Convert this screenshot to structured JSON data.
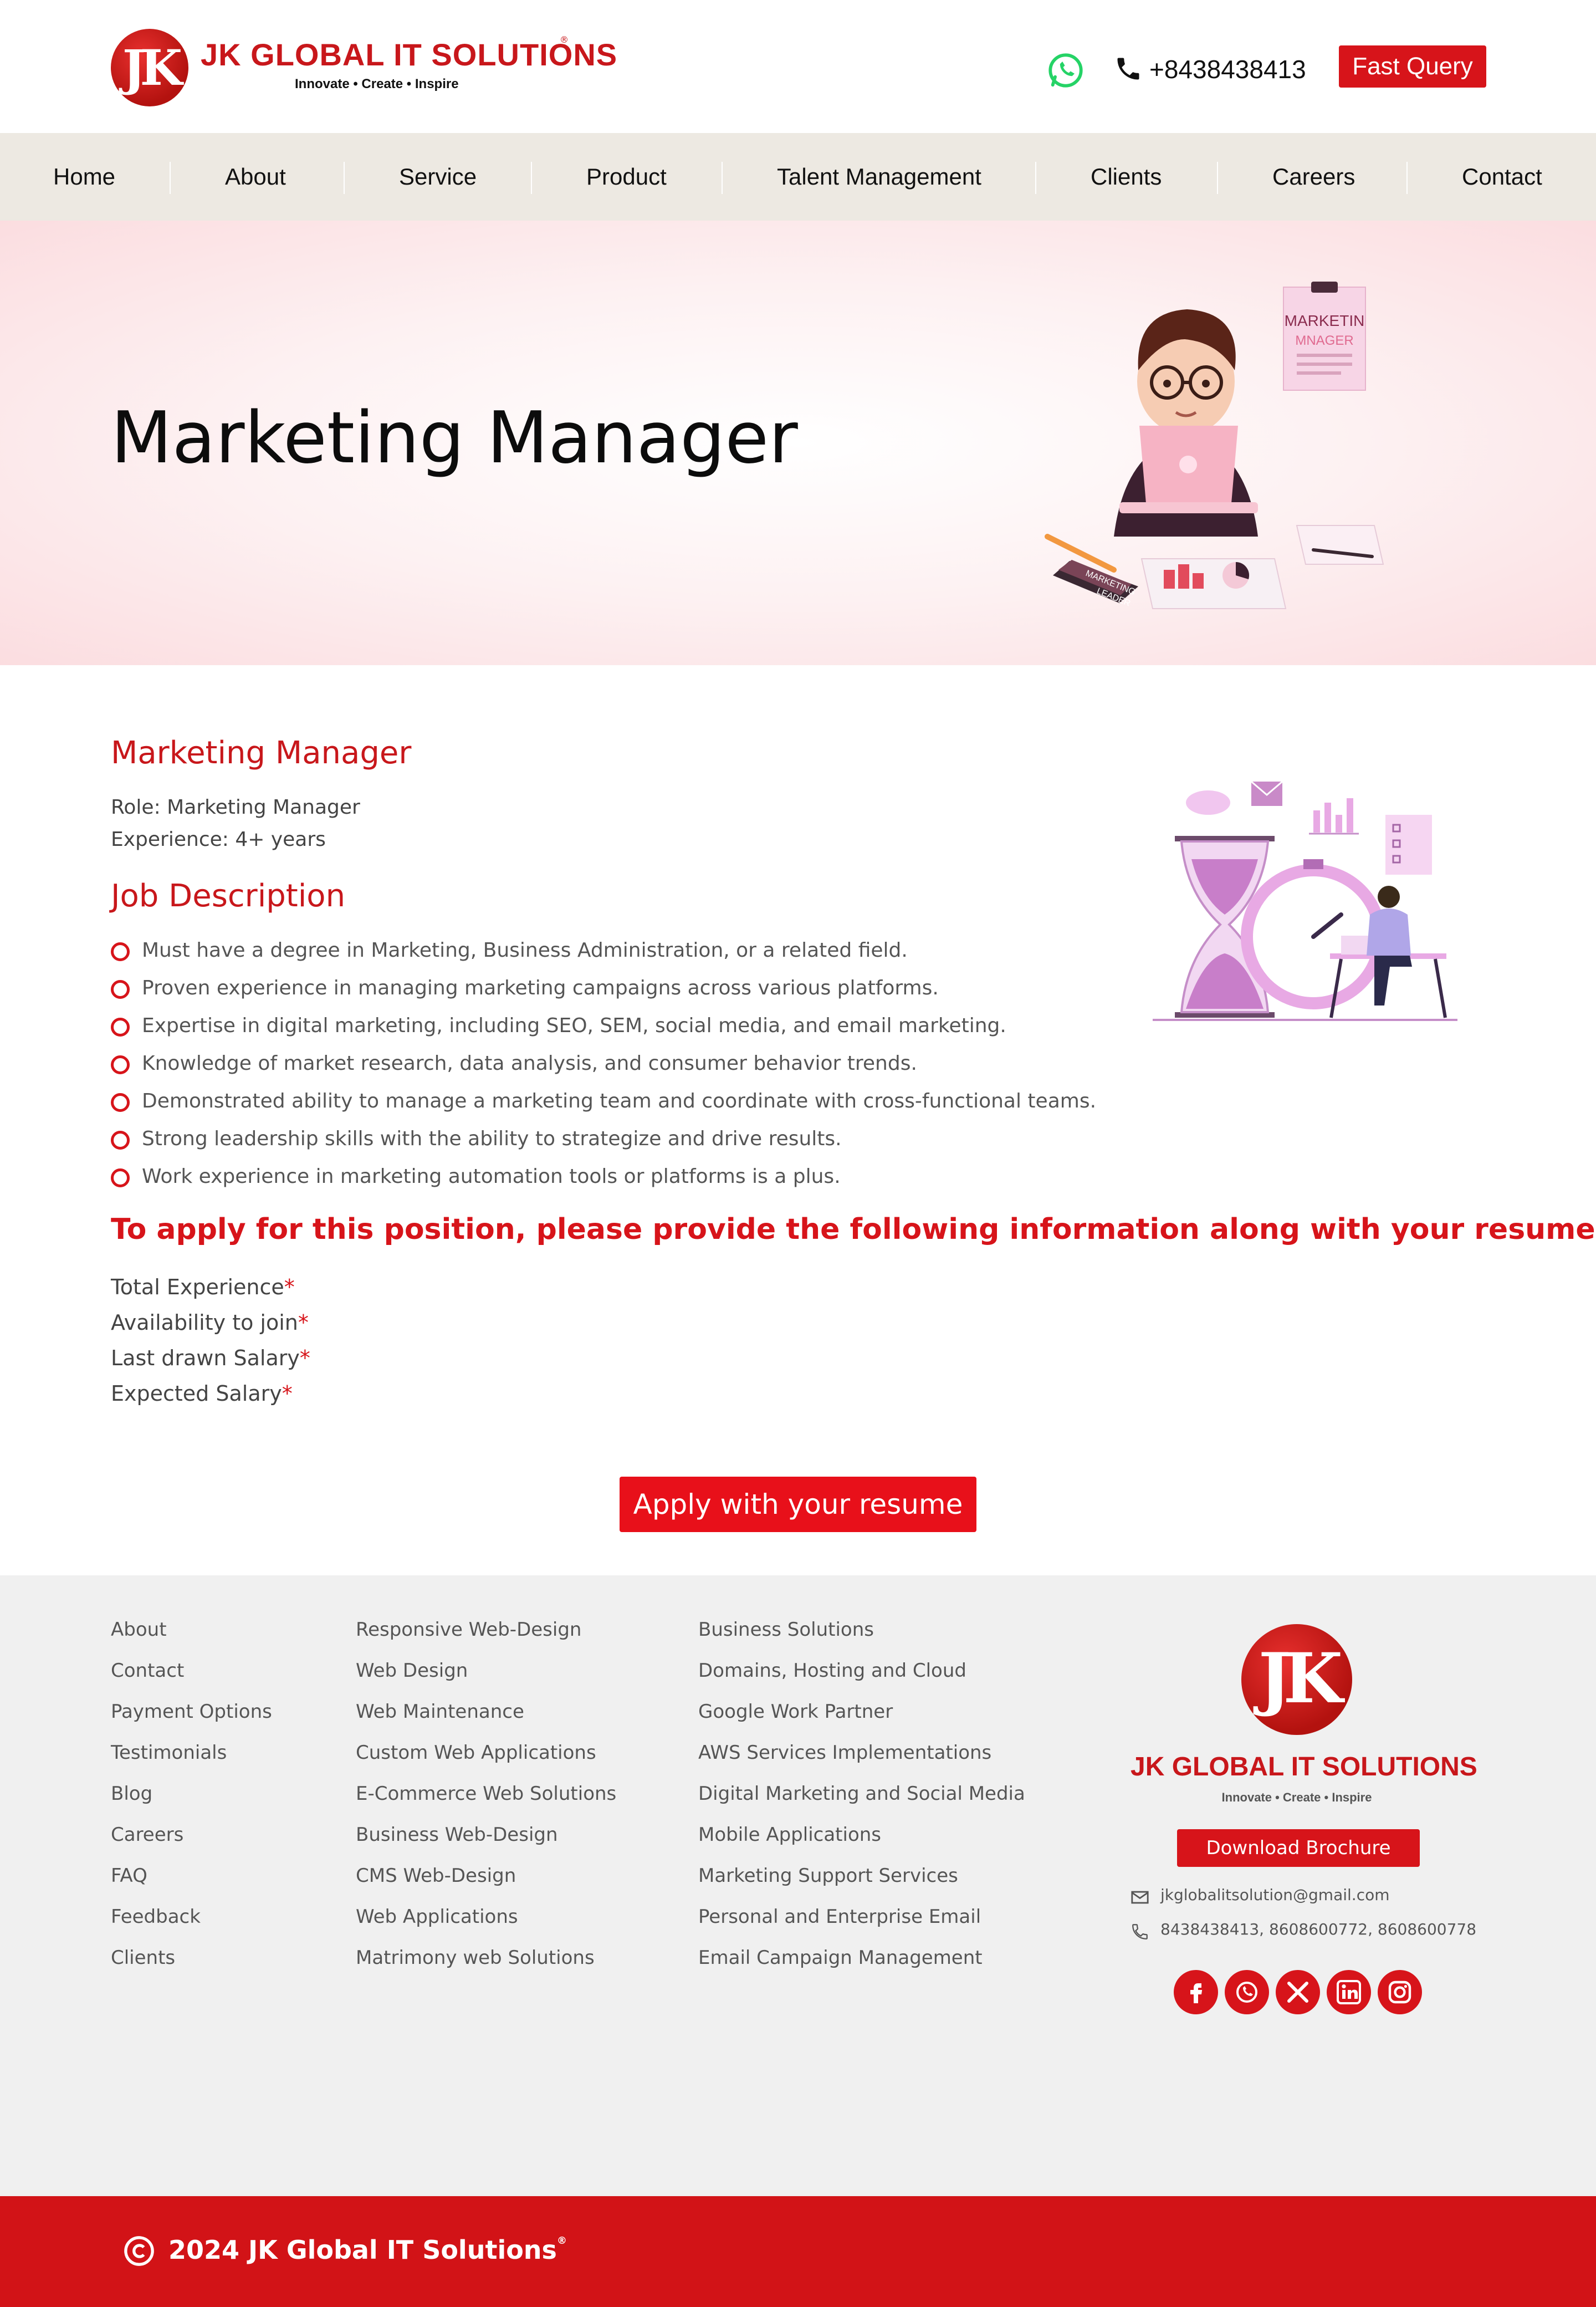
{
  "brand": {
    "name": "JK GLOBAL IT SOLUTIONS",
    "monogram": "JK",
    "tagline": "Innovate • Create • Inspire",
    "reg_mark": "®"
  },
  "header": {
    "phone": "+8438438413",
    "fast_query_label": "Fast Query",
    "icons": [
      "whatsapp-icon",
      "phone-icon"
    ]
  },
  "nav": {
    "items": [
      {
        "label": "Home"
      },
      {
        "label": "About"
      },
      {
        "label": "Service"
      },
      {
        "label": "Product"
      },
      {
        "label": "Talent Management"
      },
      {
        "label": "Clients"
      },
      {
        "label": "Careers"
      },
      {
        "label": "Contact"
      }
    ]
  },
  "hero": {
    "title": "Marketing Manager",
    "clipboard_line1": "MARKETIN",
    "clipboard_line2": "MNAGER",
    "book_label_1": "MARKETING",
    "book_label_2": "LEADER"
  },
  "job": {
    "title": "Marketing Manager",
    "role": "Role: Marketing Manager",
    "experience": "Experience: 4+ years",
    "description_heading": "Job Description",
    "requirements": [
      "Must have a degree in Marketing, Business Administration, or a related field.",
      "Proven experience in managing marketing campaigns across various platforms.",
      "Expertise in digital marketing, including SEO, SEM, social media, and email marketing.",
      "Knowledge of market research, data analysis, and consumer behavior trends.",
      "Demonstrated ability to manage a marketing team and coordinate with cross-functional teams.",
      "Strong leadership skills with the ability to strategize and drive results.",
      "Work experience in marketing automation tools or platforms is a plus."
    ],
    "apply_heading": "To apply for this position, please provide the following information along with your resume:",
    "fields": [
      {
        "label": "Total Experience",
        "required": "*"
      },
      {
        "label": "Availability to join",
        "required": "*"
      },
      {
        "label": "Last drawn Salary",
        "required": "*"
      },
      {
        "label": "Expected Salary",
        "required": "*"
      }
    ],
    "apply_button": "Apply with your resume"
  },
  "footer": {
    "col1": [
      "About",
      "Contact",
      "Payment Options",
      "Testimonials",
      "Blog",
      "Careers",
      "FAQ",
      "Feedback",
      "Clients"
    ],
    "col2": [
      "Responsive Web-Design",
      "Web Design",
      "Web Maintenance",
      "Custom Web Applications",
      "E-Commerce Web Solutions",
      "Business Web-Design",
      "CMS Web-Design",
      "Web Applications",
      "Matrimony web Solutions"
    ],
    "col3": [
      "Business Solutions",
      "Domains, Hosting and Cloud",
      "Google Work Partner",
      "AWS Services Implementations",
      "Digital Marketing and Social Media",
      "Mobile Applications",
      "Marketing Support Services",
      "Personal and Enterprise Email",
      "Email Campaign Management"
    ],
    "download_label": "Download Brochure",
    "email": "jkglobalitsolution@gmail.com",
    "phones": "8438438413, 8608600772, 8608600778",
    "social": [
      "facebook-icon",
      "whatsapp-icon",
      "x-icon",
      "linkedin-icon",
      "instagram-icon"
    ]
  },
  "copyright": {
    "text": "2024 JK Global IT Solutions",
    "reg_mark": "®"
  },
  "colors": {
    "brand_red": "#d7141a",
    "nav_bg": "#ede9e2",
    "footer_bg": "#f0f0f0",
    "bottom_bar": "#d21317"
  }
}
